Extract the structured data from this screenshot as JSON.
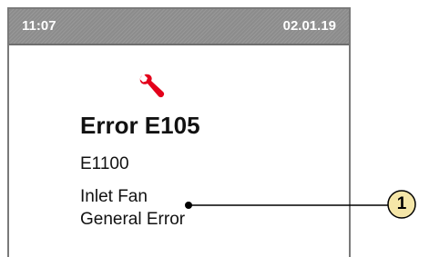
{
  "status_bar": {
    "time": "11:07",
    "date": "02.01.19"
  },
  "error": {
    "icon": "wrench-icon",
    "icon_color": "#e3001b",
    "title": "Error E105",
    "code": "E1100",
    "line1": "Inlet Fan",
    "line2": "General Error"
  },
  "callout": {
    "number": "1",
    "fill_color": "#f5e6a8"
  }
}
